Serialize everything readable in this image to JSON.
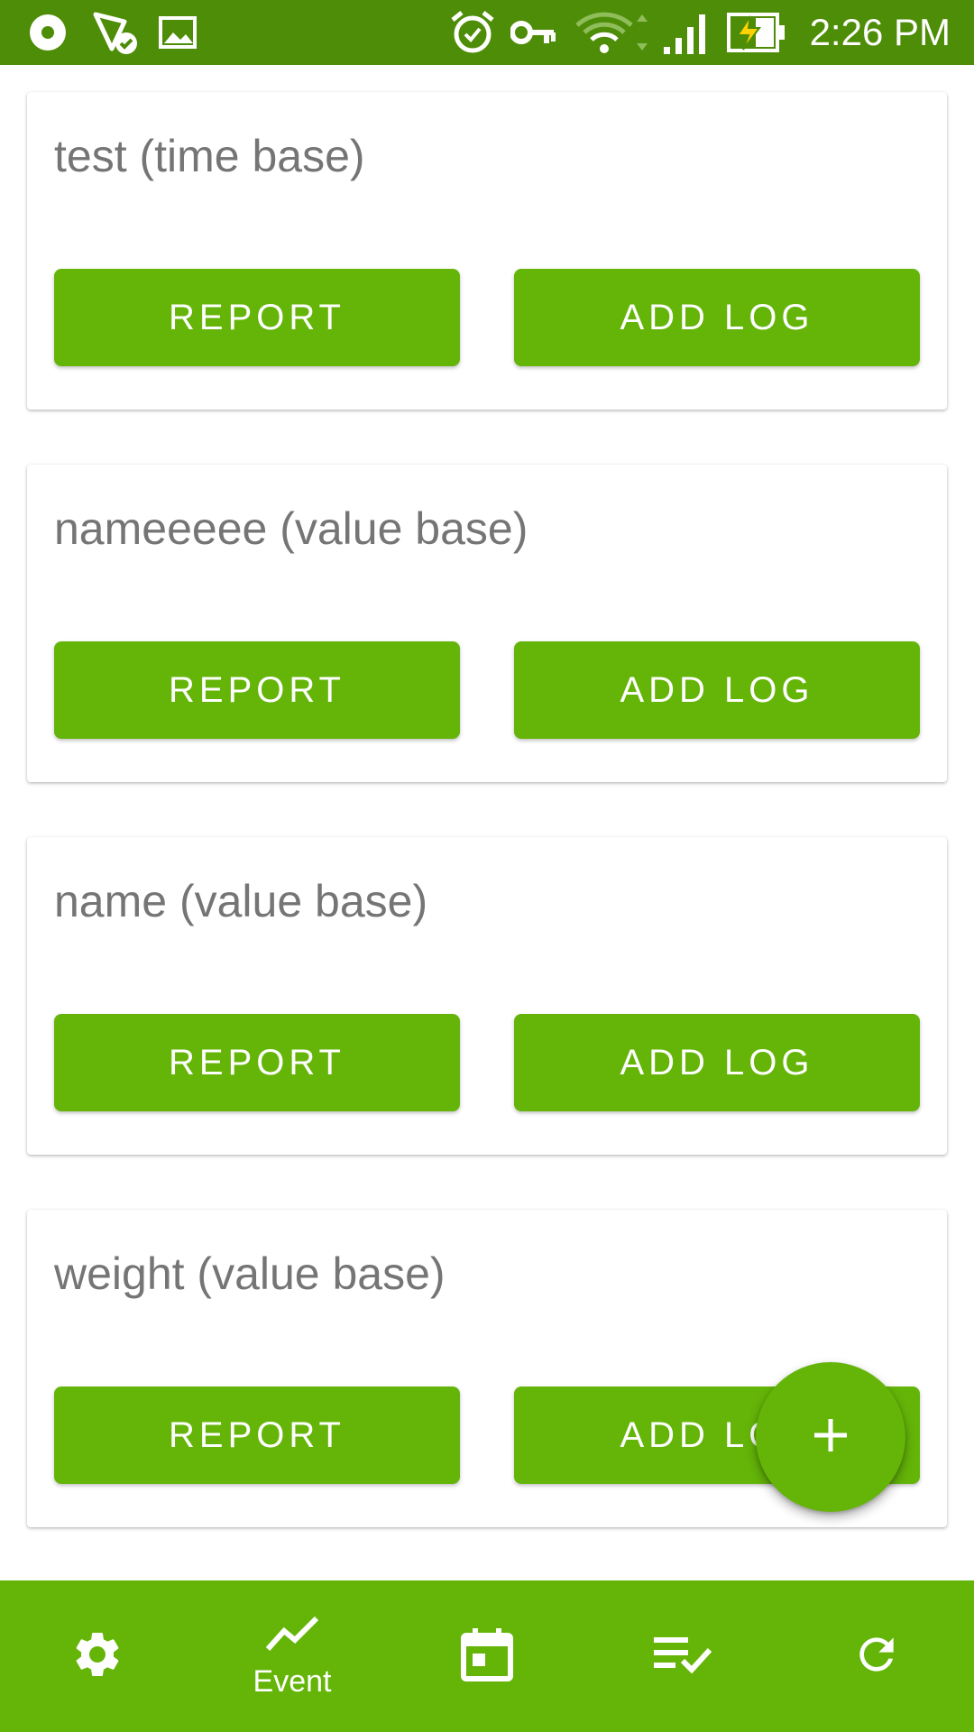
{
  "status_bar": {
    "time": "2:26 PM",
    "left_icons": [
      "record-icon",
      "location-check-icon",
      "image-icon"
    ],
    "right_icons": [
      "alarm-icon",
      "vpn-key-icon",
      "wifi-icon",
      "signal-icon",
      "battery-charging-icon"
    ]
  },
  "events": [
    {
      "title": "test (time base)",
      "report_label": "REPORT",
      "add_log_label": "ADD LOG"
    },
    {
      "title": "nameeeee (value base)",
      "report_label": "REPORT",
      "add_log_label": "ADD LOG"
    },
    {
      "title": "name (value base)",
      "report_label": "REPORT",
      "add_log_label": "ADD LOG"
    },
    {
      "title": "weight (value base)",
      "report_label": "REPORT",
      "add_log_label": "ADD LOG"
    }
  ],
  "fab": {
    "icon": "plus-icon"
  },
  "bottom_nav": {
    "items": [
      {
        "icon": "gear-icon",
        "label": ""
      },
      {
        "icon": "trending-line-icon",
        "label": "Event"
      },
      {
        "icon": "calendar-icon",
        "label": ""
      },
      {
        "icon": "checklist-icon",
        "label": ""
      },
      {
        "icon": "refresh-icon",
        "label": ""
      }
    ]
  },
  "colors": {
    "status_bar": "#4e8d07",
    "primary": "#64b508",
    "title_text": "#757575"
  }
}
